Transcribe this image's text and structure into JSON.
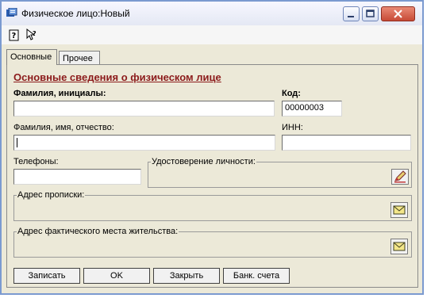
{
  "window": {
    "title": "Физическое лицо:Новый"
  },
  "toolbar": {
    "icons": [
      "help-book-icon",
      "context-help-icon"
    ]
  },
  "tabs": [
    {
      "label": "Основные",
      "active": true
    },
    {
      "label": "Прочее",
      "active": false
    }
  ],
  "section": {
    "heading": "Основные сведения о физическом лице"
  },
  "fields": {
    "short_name_label": "Фамилия, инициалы:",
    "short_name_value": "",
    "code_label": "Код:",
    "code_value": "00000003",
    "full_name_label": "Фамилия, имя, отчество:",
    "full_name_value": "",
    "inn_label": "ИНН:",
    "inn_value": "",
    "phones_label": "Телефоны:",
    "phones_value": ""
  },
  "groups": {
    "id_doc_label": "Удостоверение личности:",
    "reg_address_label": "Адрес прописки:",
    "actual_address_label": "Адрес фактического места жительства:"
  },
  "buttons": {
    "save": "Записать",
    "ok": "OK",
    "close": "Закрыть",
    "bank": "Банк. счета"
  }
}
